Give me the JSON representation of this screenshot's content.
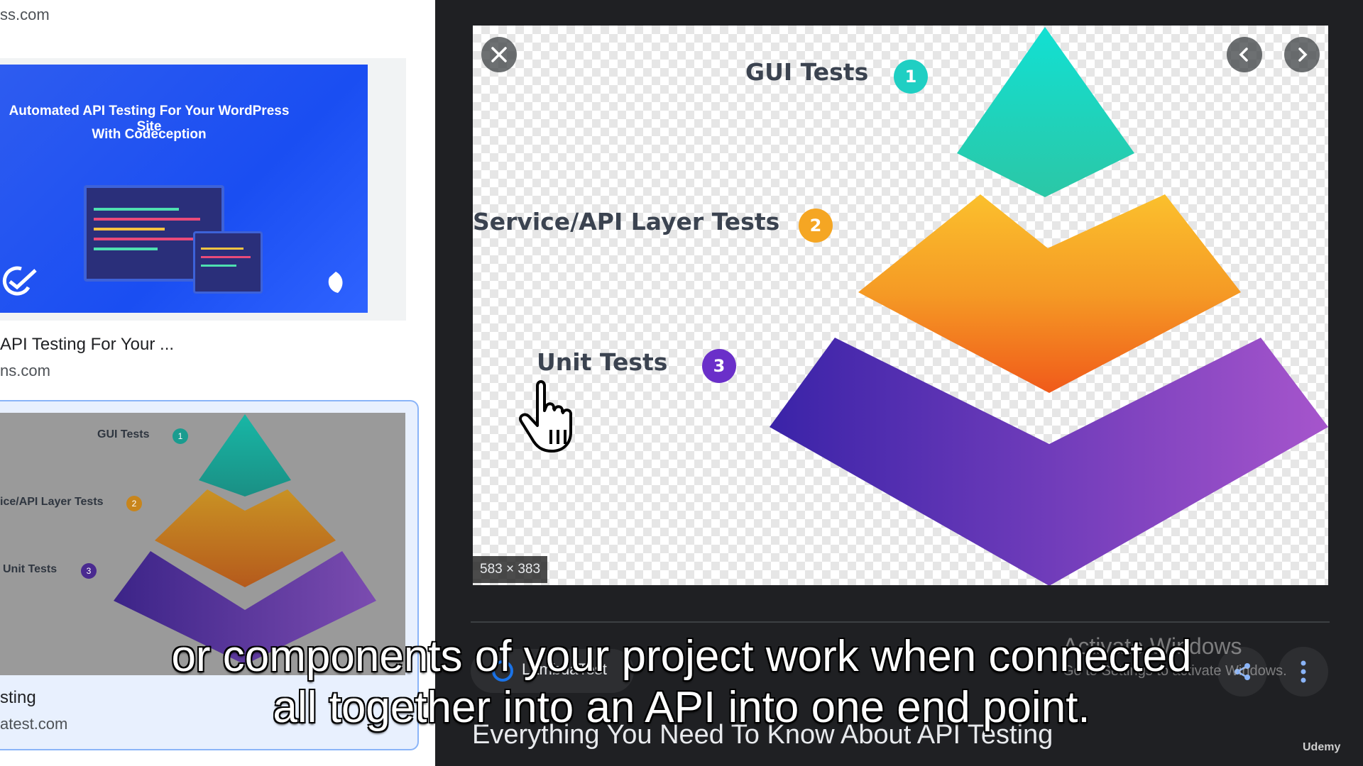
{
  "left": {
    "result1_domain": "ss.com",
    "result2_thumb_title_line1": "Automated API Testing For Your WordPress Site",
    "result2_thumb_title_line2": "With Codeception",
    "result2_title": "API Testing For Your ...",
    "result2_domain": "ns.com",
    "result3_thumb_labels": [
      "GUI Tests",
      "ice/API Layer Tests",
      "Unit Tests"
    ],
    "result3_thumb_badges": [
      "1",
      "2",
      "3"
    ],
    "result3_title": "sting",
    "result3_domain": "atest.com"
  },
  "viewer": {
    "labels": [
      "GUI Tests",
      "Service/API Layer Tests",
      "Unit Tests"
    ],
    "badges": [
      "1",
      "2",
      "3"
    ],
    "badge_colors": [
      "#1fcfc3",
      "#f5a623",
      "#6a2fc9"
    ],
    "dimensions": "583 × 383",
    "close_icon": "close-icon",
    "prev_icon": "chevron-left-icon",
    "next_icon": "chevron-right-icon",
    "source_name": "LambdaTest",
    "title": "Everything You Need To Know About API Testing"
  },
  "overlay": {
    "caption_line1": "or components of your project work when connected",
    "caption_line2": "all together into an API into one end point.",
    "watermark_line1": "Activate Windows",
    "watermark_line2": "Go to Settings to activate Windows.",
    "brand": "Udemy"
  }
}
